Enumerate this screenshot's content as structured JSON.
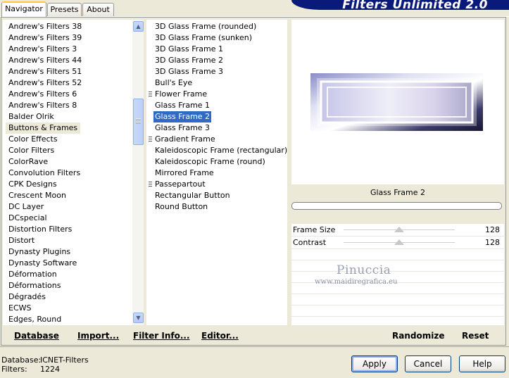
{
  "tabs": [
    {
      "label": "Navigator",
      "active": true
    },
    {
      "label": "Presets",
      "active": false
    },
    {
      "label": "About",
      "active": false
    }
  ],
  "brand": {
    "title": "Filters Unlimited 2.0"
  },
  "categories": {
    "items": [
      "Andrew's Filters 38",
      "Andrew's Filters 39",
      "Andrew's Filters 3",
      "Andrew's Filters 44",
      "Andrew's Filters 51",
      "Andrew's Filters 52",
      "Andrew's Filters 6",
      "Andrew's Filters 8",
      "Balder Olrik",
      "Buttons & Frames",
      "Color Effects",
      "Color Filters",
      "ColorRave",
      "Convolution Filters",
      "CPK Designs",
      "Crescent Moon",
      "DC Layer",
      "DCspecial",
      "Distortion Filters",
      "Distort",
      "Dynasty Plugins",
      "Dynasty Software",
      "Déformation",
      "Déformations",
      "Dégradés",
      "ECWS",
      "Edges, Round"
    ],
    "selected_index": 9
  },
  "filters": {
    "items": [
      {
        "label": "3D Glass Frame (rounded)",
        "marker": false
      },
      {
        "label": "3D Glass Frame (sunken)",
        "marker": false
      },
      {
        "label": "3D Glass Frame 1",
        "marker": false
      },
      {
        "label": "3D Glass Frame 2",
        "marker": false
      },
      {
        "label": "3D Glass Frame 3",
        "marker": false
      },
      {
        "label": "Bull's Eye",
        "marker": false
      },
      {
        "label": "Flower Frame",
        "marker": true
      },
      {
        "label": "Glass Frame 1",
        "marker": false
      },
      {
        "label": "Glass Frame 2",
        "marker": false
      },
      {
        "label": "Glass Frame 3",
        "marker": false
      },
      {
        "label": "Gradient Frame",
        "marker": true
      },
      {
        "label": "Kaleidoscopic Frame (rectangular)",
        "marker": false
      },
      {
        "label": "Kaleidoscopic Frame (round)",
        "marker": false
      },
      {
        "label": "Mirrored Frame",
        "marker": false
      },
      {
        "label": "Passepartout",
        "marker": true
      },
      {
        "label": "Rectangular Button",
        "marker": false
      },
      {
        "label": "Round Button",
        "marker": false
      }
    ],
    "selected_index": 8
  },
  "preview": {
    "filter_name": "Glass Frame 2"
  },
  "params": [
    {
      "label": "Frame Size",
      "value": "128",
      "level": 128,
      "max": 255
    },
    {
      "label": "Contrast",
      "value": "128",
      "level": 128,
      "max": 255
    }
  ],
  "watermark": {
    "name": "Pinuccia",
    "url": "www.maidiregrafica.eu"
  },
  "bottom_links": {
    "database": "Database",
    "import": "Import...",
    "filter_info": "Filter Info...",
    "editor": "Editor...",
    "randomize": "Randomize",
    "reset": "Reset"
  },
  "status": {
    "database_label": "Database:",
    "database_value": "ICNET-Filters",
    "filters_label": "Filters:",
    "filters_value": "1224"
  },
  "buttons": {
    "apply": "Apply",
    "cancel": "Cancel",
    "help": "Help"
  },
  "colors": {
    "selection": "#316ac5",
    "banner": "#0a1a7a",
    "window_bg": "#ece9d8"
  }
}
